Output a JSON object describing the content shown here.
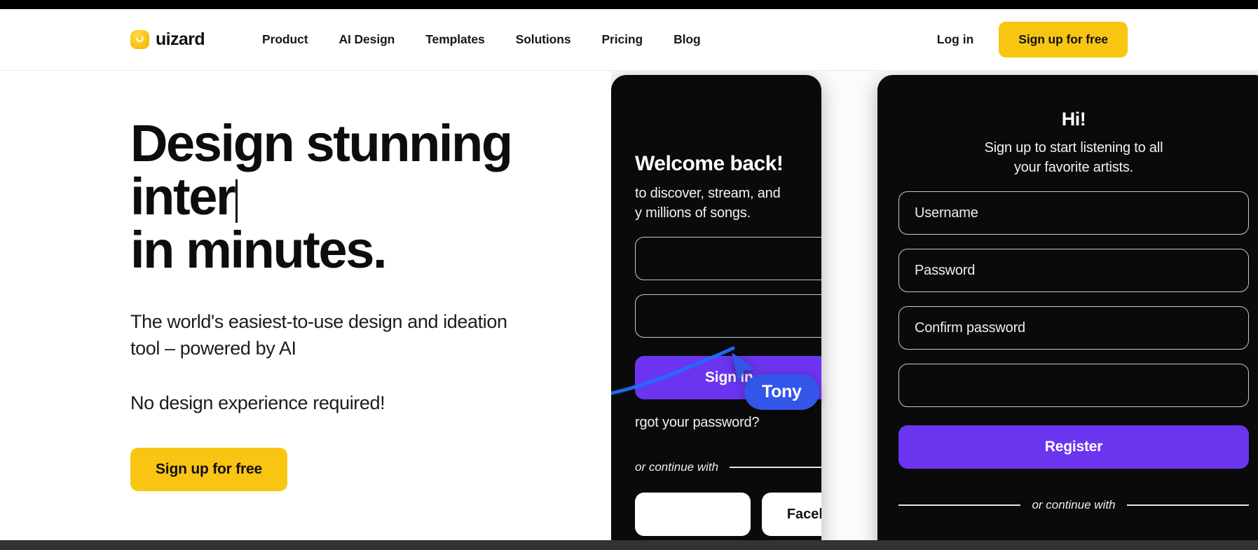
{
  "brand": {
    "name": "uizard",
    "logo_icon": "uizard-smiley-logo-icon",
    "logo_color": "#f9c513"
  },
  "nav": {
    "links": [
      {
        "label": "Product"
      },
      {
        "label": "AI Design"
      },
      {
        "label": "Templates"
      },
      {
        "label": "Solutions"
      },
      {
        "label": "Pricing"
      },
      {
        "label": "Blog"
      }
    ],
    "login_label": "Log in",
    "signup_label": "Sign up for free"
  },
  "hero": {
    "headline_line1": "Design stunning",
    "headline_line2": "inter",
    "headline_line3": "in minutes.",
    "subtitle": "The world's easiest-to-use design and ideation tool – powered by AI",
    "subtitle_2": "No design experience required!",
    "cta_label": "Sign up for free"
  },
  "mockup": {
    "signin_card": {
      "title": "Welcome back!",
      "subtitle_line1": "to discover, stream, and",
      "subtitle_line2": "y millions of songs.",
      "field_1": "",
      "field_2": "",
      "primary_button": "Sign in",
      "forgot_label": "rgot your password?",
      "divider_label": "or continue with",
      "social_1": "",
      "social_2": "Facebook"
    },
    "signup_card": {
      "title": "Hi!",
      "subtitle_line1": "Sign up to start listening to all",
      "subtitle_line2": "your favorite artists.",
      "field_username": "Username",
      "field_password": "Password",
      "field_confirm": "Confirm password",
      "field_extra": "",
      "primary_button": "Register",
      "divider_label": "or continue with"
    },
    "collaborator": {
      "name": "Tony",
      "cursor_color": "#3355e8"
    }
  },
  "colors": {
    "accent_yellow": "#f9c513",
    "purple": "#6b35ef",
    "collab_blue": "#3355e8",
    "card_black": "#0a0a0a",
    "text_dark": "#0d0d0d"
  }
}
